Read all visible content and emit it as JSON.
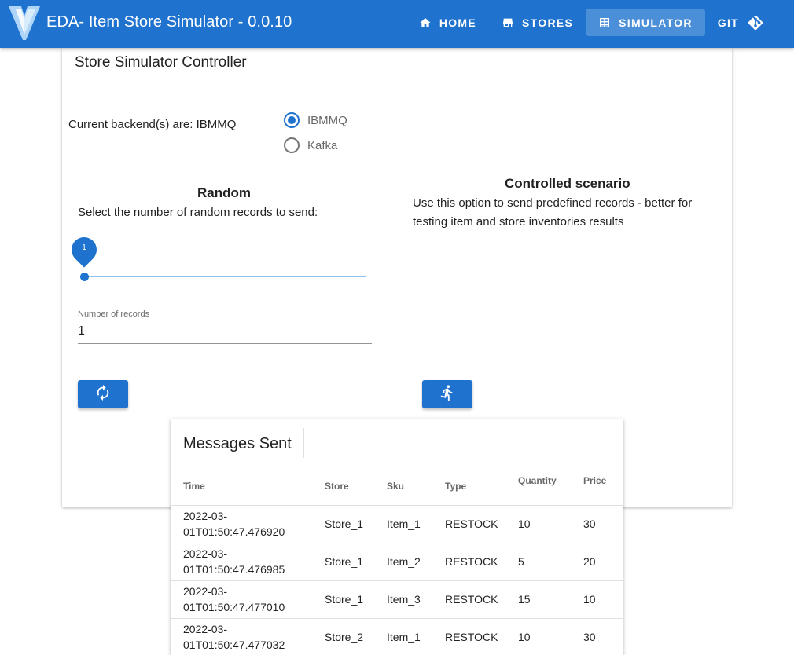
{
  "appbar": {
    "title": "EDA- Item Store Simulator - 0.0.10",
    "color": "#1f73cf",
    "nav": [
      {
        "label": "HOME",
        "icon": "home-icon"
      },
      {
        "label": "STORES",
        "icon": "store-icon"
      },
      {
        "label": "SIMULATOR",
        "icon": "table-icon",
        "active": true
      },
      {
        "label": "GIT",
        "icon": "git-icon"
      }
    ]
  },
  "controller": {
    "title": "Store Simulator Controller",
    "backend_text": "Current backend(s) are: IBMMQ",
    "backends": [
      {
        "label": "IBMMQ",
        "selected": true
      },
      {
        "label": "Kafka",
        "selected": false
      }
    ]
  },
  "random": {
    "title": "Random",
    "description": "Select the number of random records to send:",
    "slider_value": "1",
    "field_label": "Number of records",
    "field_value": "1",
    "button_icon": "refresh-icon"
  },
  "controlled": {
    "title": "Controlled scenario",
    "description": "Use this option to send predefined records - better for testing item and store inventories results",
    "button_icon": "run-icon"
  },
  "messages": {
    "title": "Messages Sent",
    "columns": [
      "Time",
      "Store",
      "Sku",
      "Type",
      "Quantity",
      "Price"
    ],
    "rows": [
      {
        "time": "2022-03-01T01:50:47.476920",
        "store": "Store_1",
        "sku": "Item_1",
        "type": "RESTOCK",
        "quantity": "10",
        "price": "30"
      },
      {
        "time": "2022-03-01T01:50:47.476985",
        "store": "Store_1",
        "sku": "Item_2",
        "type": "RESTOCK",
        "quantity": "5",
        "price": "20"
      },
      {
        "time": "2022-03-01T01:50:47.477010",
        "store": "Store_1",
        "sku": "Item_3",
        "type": "RESTOCK",
        "quantity": "15",
        "price": "10"
      },
      {
        "time": "2022-03-01T01:50:47.477032",
        "store": "Store_2",
        "sku": "Item_1",
        "type": "RESTOCK",
        "quantity": "10",
        "price": "30"
      }
    ]
  }
}
